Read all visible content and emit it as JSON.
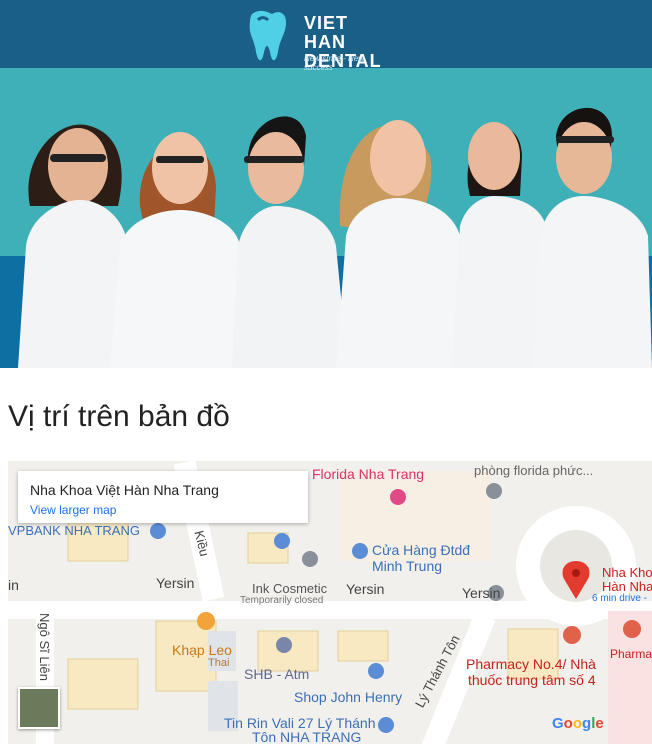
{
  "brand": {
    "name": "VIET HAN DENTAL",
    "line1": "VIET HAN",
    "line2": "DENTAL",
    "tagline": "New smile - New success",
    "colors": {
      "dark_blue": "#1a5f86",
      "teal": "#3fb0b7",
      "deep_blue": "#0e6fa3"
    }
  },
  "section": {
    "title": "Vị trí trên bản đồ"
  },
  "map": {
    "card": {
      "name": "Nha Khoa Việt Hàn Nha Trang",
      "link": "View larger map"
    },
    "streets": {
      "yersin1": "Yersin",
      "yersin2": "Yersin",
      "yersin3": "Yersin",
      "in": "in",
      "ngo_si_lien": "Ngô Sĩ Liên",
      "ly_thanh_ton": "Lý Thánh Tôn",
      "kieu": "Kiều"
    },
    "pois": {
      "florida": "Florida Nha Trang",
      "phong_florida": "phòng florida phức...",
      "vpbank": "VPBANK NHA TRANG",
      "cua_hang_1": "Cửa Hàng Đtdđ",
      "cua_hang_2": "Minh Trung",
      "ink_cosmetic": "Ink Cosmetic",
      "temporarily_closed": "Temporarily closed",
      "khap_leo": "Khạp Leo",
      "thai": "Thai",
      "shb": "SHB - Atm",
      "shop_john": "Shop John Henry",
      "tin_rin_1": "Tin Rin Vali 27 Lý Thánh",
      "tin_rin_2": "Tôn NHA TRANG",
      "pharmacy_1": "Pharmacy No.4/ Nhà",
      "pharmacy_2": "thuốc trung tâm số 4",
      "pharma_edge": "Pharmac",
      "marker_1": "Nha Khoa",
      "marker_2": "Hàn Nha T",
      "drive": "6 min drive -"
    },
    "google": [
      "G",
      "o",
      "o",
      "g",
      "l",
      "e"
    ]
  }
}
